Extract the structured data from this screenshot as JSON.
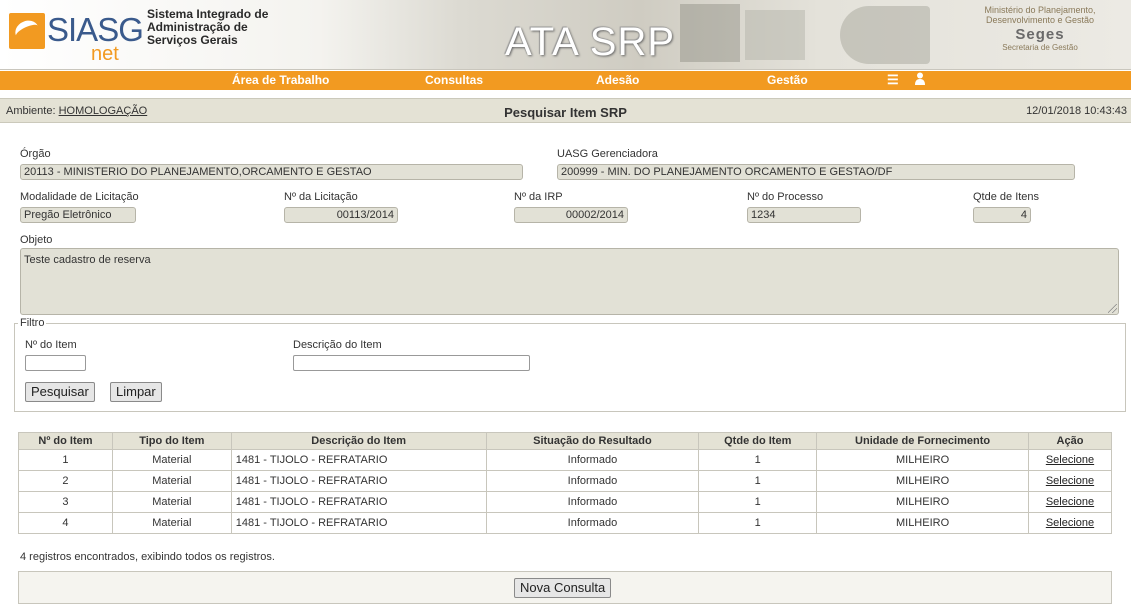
{
  "header": {
    "logo_main": "SIASG",
    "logo_sub": "net",
    "system_name_lines": [
      "Sistema Integrado de",
      "Administração de",
      "Serviços Gerais"
    ],
    "module_title": "ATA SRP",
    "ministry_lines": [
      "Ministério do Planejamento,",
      "Desenvolvimento e Gestão"
    ],
    "seges": "Seges",
    "seges_sub": "Secretaria de Gestão"
  },
  "nav": {
    "items": [
      "Área de Trabalho",
      "Consultas",
      "Adesão",
      "Gestão"
    ],
    "menu_icon": "hamburger-icon",
    "user_icon": "user-icon"
  },
  "status": {
    "env_label": "Ambiente:",
    "env_value": "HOMOLOGAÇÃO",
    "page_title": "Pesquisar Item SRP",
    "datetime": "12/01/2018 10:43:43"
  },
  "form": {
    "orgao_label": "Órgão",
    "orgao_value": "20113 - MINISTERIO DO PLANEJAMENTO,ORCAMENTO E GESTAO",
    "uasg_label": "UASG Gerenciadora",
    "uasg_value": "200999 - MIN. DO PLANEJAMENTO ORCAMENTO E GESTAO/DF",
    "modalidade_label": "Modalidade de Licitação",
    "modalidade_value": "Pregão Eletrônico",
    "licitacao_label": "Nº da Licitação",
    "licitacao_value": "00113/2014",
    "irp_label": "Nº da IRP",
    "irp_value": "00002/2014",
    "processo_label": "Nº do Processo",
    "processo_value": "1234",
    "qtde_label": "Qtde de Itens",
    "qtde_value": "4",
    "objeto_label": "Objeto",
    "objeto_value": "Teste cadastro de reserva"
  },
  "filter": {
    "legend": "Filtro",
    "item_label": "Nº do Item",
    "item_value": "",
    "desc_label": "Descrição do Item",
    "desc_value": "",
    "search_button": "Pesquisar",
    "clear_button": "Limpar"
  },
  "table": {
    "headers": [
      "Nº do Item",
      "Tipo do Item",
      "Descrição do Item",
      "Situação do Resultado",
      "Qtde do Item",
      "Unidade de Fornecimento",
      "Ação"
    ],
    "rows": [
      [
        "1",
        "Material",
        "1481 - TIJOLO - REFRATARIO",
        "Informado",
        "1",
        "MILHEIRO",
        "Selecione"
      ],
      [
        "2",
        "Material",
        "1481 - TIJOLO - REFRATARIO",
        "Informado",
        "1",
        "MILHEIRO",
        "Selecione"
      ],
      [
        "3",
        "Material",
        "1481 - TIJOLO - REFRATARIO",
        "Informado",
        "1",
        "MILHEIRO",
        "Selecione"
      ],
      [
        "4",
        "Material",
        "1481 - TIJOLO - REFRATARIO",
        "Informado",
        "1",
        "MILHEIRO",
        "Selecione"
      ]
    ]
  },
  "records_text": "4 registros encontrados, exibindo todos os registros.",
  "new_query_button": "Nova Consulta",
  "colors": {
    "accent": "#f29a21",
    "bar": "#e4e2d5",
    "field": "#e2e1d6"
  }
}
